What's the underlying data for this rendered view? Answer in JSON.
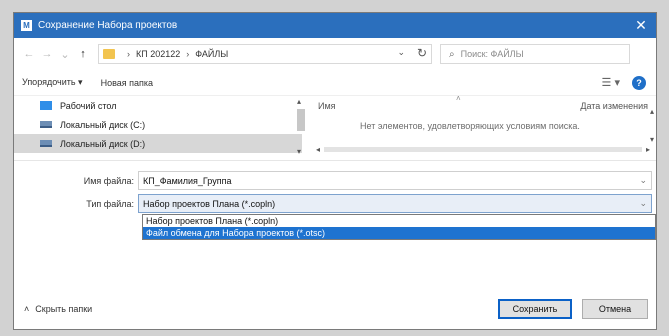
{
  "window": {
    "icon": "app-icon",
    "title": "Сохранение Набора проектов",
    "close_symbol": "✕"
  },
  "nav": {
    "back": "←",
    "forward": "→",
    "history": "⌄",
    "up": "↑",
    "crumbs": [
      "КП 202122",
      "ФАЙЛЫ"
    ],
    "crumb_sep": "›",
    "address_dropdown": "⌄",
    "refresh": "↻",
    "search_placeholder": "Поиск: ФАЙЛЫ",
    "search_icon": "⌕"
  },
  "toolbar": {
    "organize": "Упорядочить ▾",
    "new_folder": "Новая папка",
    "view": "☰ ▾",
    "help": "?"
  },
  "nav_pane": {
    "items": [
      {
        "label": "Рабочий стол",
        "icon": "desktop-icon"
      },
      {
        "label": "Локальный диск (C:)",
        "icon": "drive-icon"
      },
      {
        "label": "Локальный диск (D:)",
        "icon": "drive-icon"
      }
    ],
    "scroll_up": "▴",
    "scroll_down": "▾"
  },
  "file_pane": {
    "col_name": "Имя",
    "col_date": "Дата изменения",
    "sort_arrow": "˄",
    "empty_message": "Нет элементов, удовлетворяющих условиям поиска.",
    "scroll_left": "◂",
    "scroll_right": "▸",
    "scroll_up": "▴",
    "scroll_down": "▾"
  },
  "form": {
    "filename_label": "Имя файла:",
    "filename_value": "КП_Фамилия_Группа",
    "filetype_label": "Тип файла:",
    "filetype_value": "Набор проектов Плана (*.copln)",
    "dropdown_symbol": "⌄",
    "options": [
      "Набор проектов Плана (*.copln)",
      "Файл обмена для Набора проектов (*.otsc)"
    ],
    "active_option_index": 1
  },
  "footer": {
    "hide_folders": "Скрыть папки",
    "hide_chevron": "˄",
    "save": "Сохранить",
    "cancel": "Отмена"
  },
  "colors": {
    "titlebar": "#2b6fbd",
    "selection": "#1e73d0",
    "help": "#1f6fc8"
  }
}
